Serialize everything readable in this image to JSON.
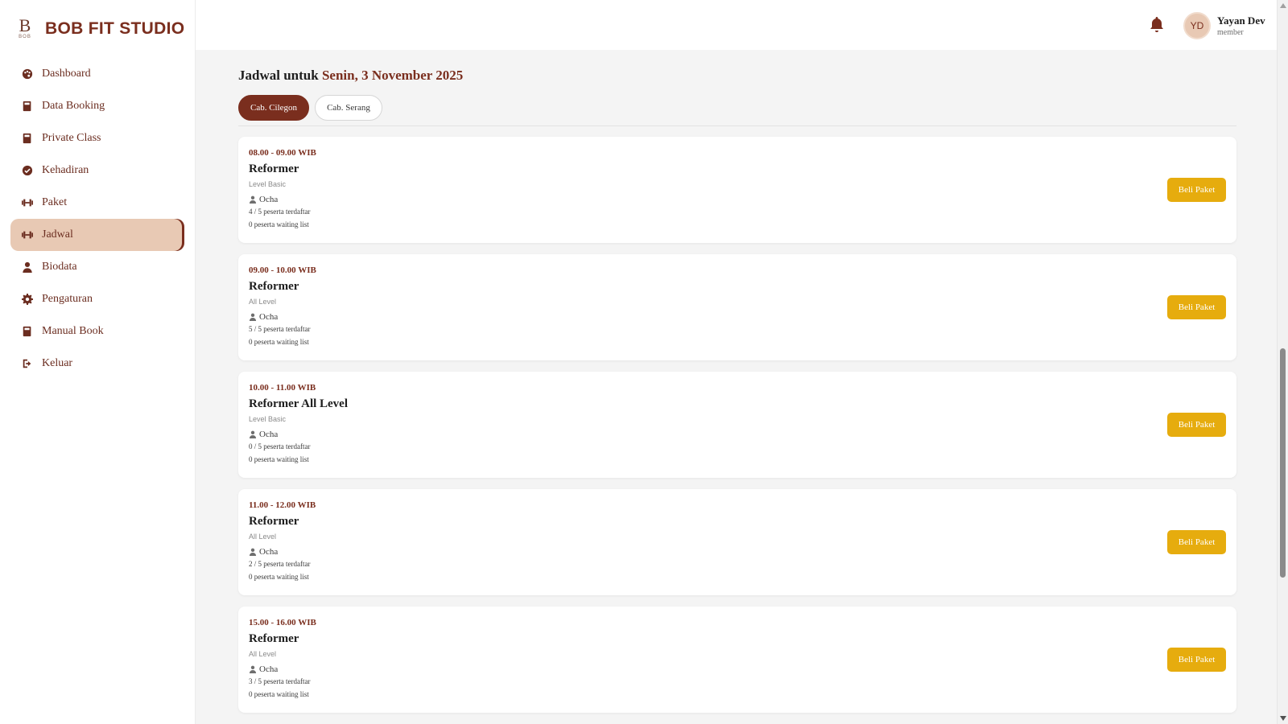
{
  "brand": {
    "logo_mark": "B",
    "logo_sub": "BOB",
    "name": "BOB FIT STUDIO"
  },
  "sidebar": {
    "items": [
      {
        "label": "Dashboard",
        "icon": "palette-icon",
        "active": false
      },
      {
        "label": "Data Booking",
        "icon": "book-icon",
        "active": false
      },
      {
        "label": "Private Class",
        "icon": "book-icon",
        "active": false
      },
      {
        "label": "Kehadiran",
        "icon": "check-circle-icon",
        "active": false
      },
      {
        "label": "Paket",
        "icon": "dumbbell-icon",
        "active": false
      },
      {
        "label": "Jadwal",
        "icon": "dumbbell-icon",
        "active": true
      },
      {
        "label": "Biodata",
        "icon": "user-icon",
        "active": false
      },
      {
        "label": "Pengaturan",
        "icon": "gear-icon",
        "active": false
      },
      {
        "label": "Manual Book",
        "icon": "book-icon",
        "active": false
      },
      {
        "label": "Keluar",
        "icon": "logout-icon",
        "active": false
      }
    ]
  },
  "header": {
    "notification_icon": "bell-icon",
    "user": {
      "initials": "YD",
      "name": "Yayan Dev",
      "role": "member"
    }
  },
  "schedule": {
    "title_prefix": "Jadwal untuk",
    "date": "Senin, 3 November 2025",
    "branches": [
      {
        "label": "Cab. Cilegon",
        "active": true
      },
      {
        "label": "Cab. Serang",
        "active": false
      }
    ],
    "classes": [
      {
        "time": "08.00 - 09.00 WIB",
        "name": "Reformer",
        "level": "Level Basic",
        "coach": "Ocha",
        "registered": "4 / 5 peserta terdaftar",
        "waiting": "0 peserta waiting list",
        "button": "Beli Paket"
      },
      {
        "time": "09.00 - 10.00 WIB",
        "name": "Reformer",
        "level": "All Level",
        "coach": "Ocha",
        "registered": "5 / 5 peserta terdaftar",
        "waiting": "0 peserta waiting list",
        "button": "Beli Paket"
      },
      {
        "time": "10.00 - 11.00 WIB",
        "name": "Reformer All Level",
        "level": "Level Basic",
        "coach": "Ocha",
        "registered": "0 / 5 peserta terdaftar",
        "waiting": "0 peserta waiting list",
        "button": "Beli Paket"
      },
      {
        "time": "11.00 - 12.00 WIB",
        "name": "Reformer",
        "level": "All Level",
        "coach": "Ocha",
        "registered": "2 / 5 peserta terdaftar",
        "waiting": "0 peserta waiting list",
        "button": "Beli Paket"
      },
      {
        "time": "15.00 - 16.00 WIB",
        "name": "Reformer",
        "level": "All Level",
        "coach": "Ocha",
        "registered": "3 / 5 peserta terdaftar",
        "waiting": "0 peserta waiting list",
        "button": "Beli Paket"
      }
    ]
  },
  "colors": {
    "brand": "#7a2e1e",
    "active_nav_bg": "#e8c9b4",
    "button": "#e6ac0e",
    "page_bg": "#f4f4f4"
  }
}
